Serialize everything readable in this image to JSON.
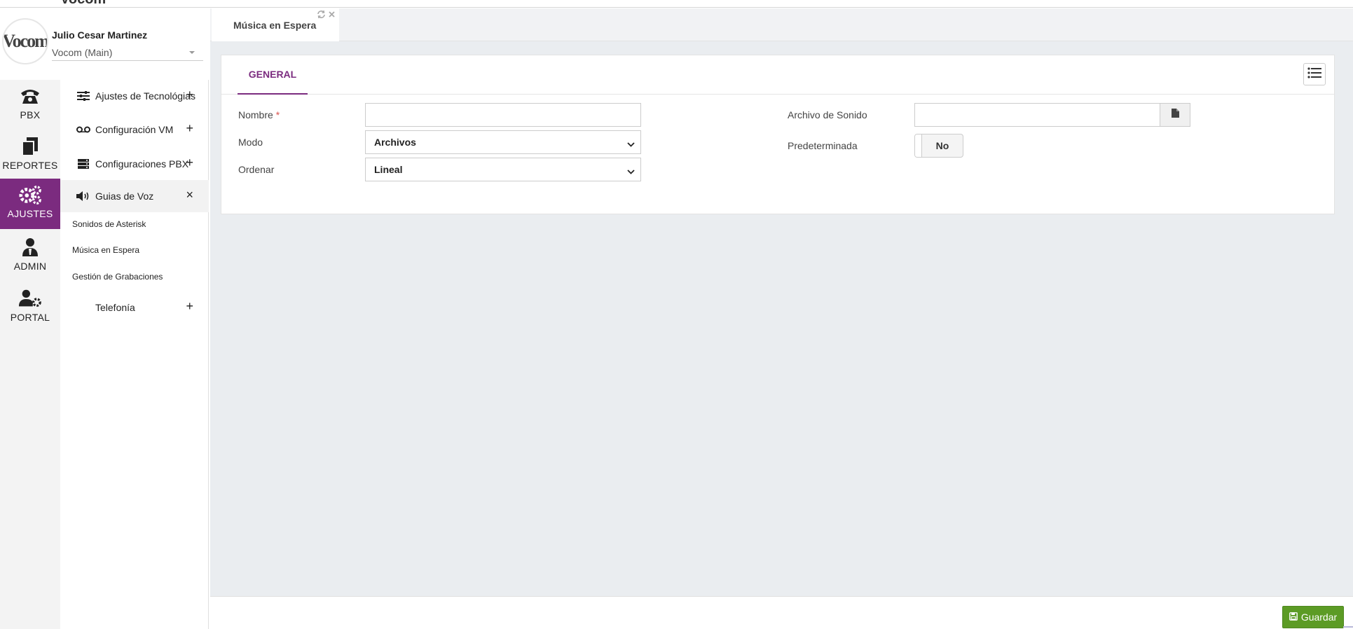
{
  "app": {
    "brand": "Vocom"
  },
  "profile": {
    "logo_text": "Vocom",
    "name": "Julio Cesar Martinez",
    "org": "Vocom (Main)"
  },
  "rail": [
    {
      "label": "PBX",
      "icon": "phone-icon"
    },
    {
      "label": "REPORTES",
      "icon": "documents-icon"
    },
    {
      "label": "AJUSTES",
      "icon": "gears-icon",
      "active": true
    },
    {
      "label": "ADMIN",
      "icon": "admin-user-icon"
    },
    {
      "label": "PORTAL",
      "icon": "user-gear-icon"
    }
  ],
  "submenu": {
    "items": [
      {
        "label": "Ajustes de Tecnológias",
        "icon": "sliders-icon",
        "action": "+"
      },
      {
        "label": "Configuración VM",
        "icon": "voicemail-icon",
        "action": "+"
      },
      {
        "label": "Configuraciones PBX",
        "icon": "server-icon",
        "action": "+"
      },
      {
        "label": "Guias de Voz",
        "icon": "volume-icon",
        "action": "×"
      },
      {
        "label": "Telefonía",
        "icon": "",
        "action": "+"
      }
    ],
    "leaves": [
      "Sonidos de Asterisk",
      "Música en Espera",
      "Gestión de Grabaciones"
    ]
  },
  "tab": {
    "label": "Música en Espera"
  },
  "card": {
    "tab_label": "GENERAL",
    "fields": {
      "nombre": {
        "label": "Nombre",
        "required_mark": "*",
        "value": ""
      },
      "modo": {
        "label": "Modo",
        "value": "Archivos"
      },
      "ordenar": {
        "label": "Ordenar",
        "value": "Lineal"
      },
      "archivo": {
        "label": "Archivo de Sonido",
        "value": ""
      },
      "predeterminada": {
        "label": "Predeterminada",
        "value": "No"
      }
    }
  },
  "footer": {
    "save_label": "Guardar"
  },
  "colors": {
    "accent": "#7b2b7f",
    "save": "#5c9b25",
    "required": "#d9534f"
  }
}
